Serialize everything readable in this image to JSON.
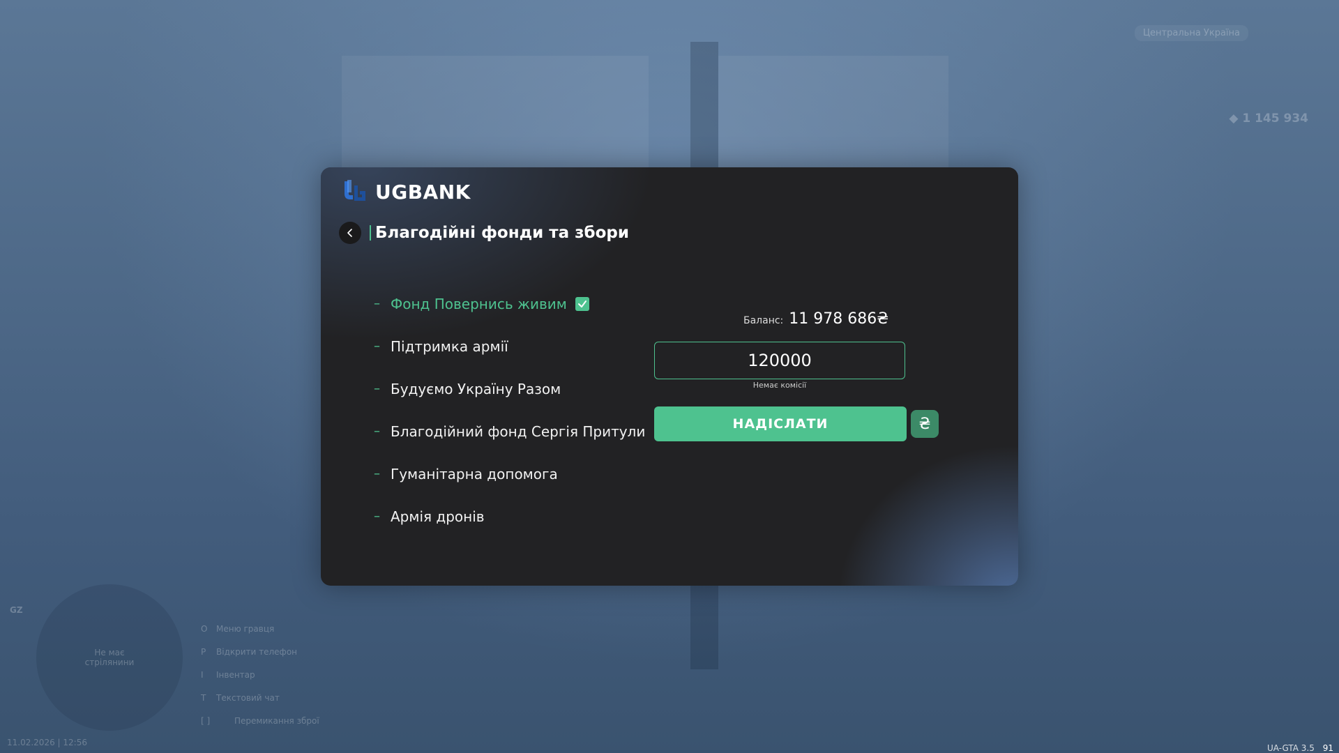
{
  "background": {
    "top_right_badge": "Центральна Україна",
    "top_right_amount": "1 145 934",
    "hints": [
      {
        "key": "O",
        "label": "Меню гравця"
      },
      {
        "key": "P",
        "label": "Відкрити телефон"
      },
      {
        "key": "I",
        "label": "Інвентар"
      },
      {
        "key": "T",
        "label": "Текстовий чат"
      },
      {
        "key": "[ ]",
        "label": "Перемикання зброї"
      }
    ],
    "minimap_text": "Не має стрілянини",
    "gz_label": "GZ",
    "datetime": "11.02.2026 | 12:56",
    "version": "UA-GTA 3.5",
    "fps": "91"
  },
  "bank": {
    "logo_text": "UGBANK",
    "title": "Благодійні фонди та збори",
    "funds": [
      {
        "label": "Фонд Повернись живим",
        "selected": true
      },
      {
        "label": "Підтримка армії",
        "selected": false
      },
      {
        "label": "Будуємо Україну Разом",
        "selected": false
      },
      {
        "label": "Благодійний фонд Сергія Притули",
        "selected": false
      },
      {
        "label": "Гуманітарна допомога",
        "selected": false
      },
      {
        "label": "Армія дронів",
        "selected": false
      }
    ],
    "balance_label": "Баланс:",
    "balance_value": "11 978 686₴",
    "amount_value": "120000",
    "commission_note": "Немає комісії",
    "send_label": "НАДІСЛАТИ",
    "currency_symbol": "₴"
  },
  "colors": {
    "accent": "#4ec28f",
    "panel": "#222224"
  }
}
